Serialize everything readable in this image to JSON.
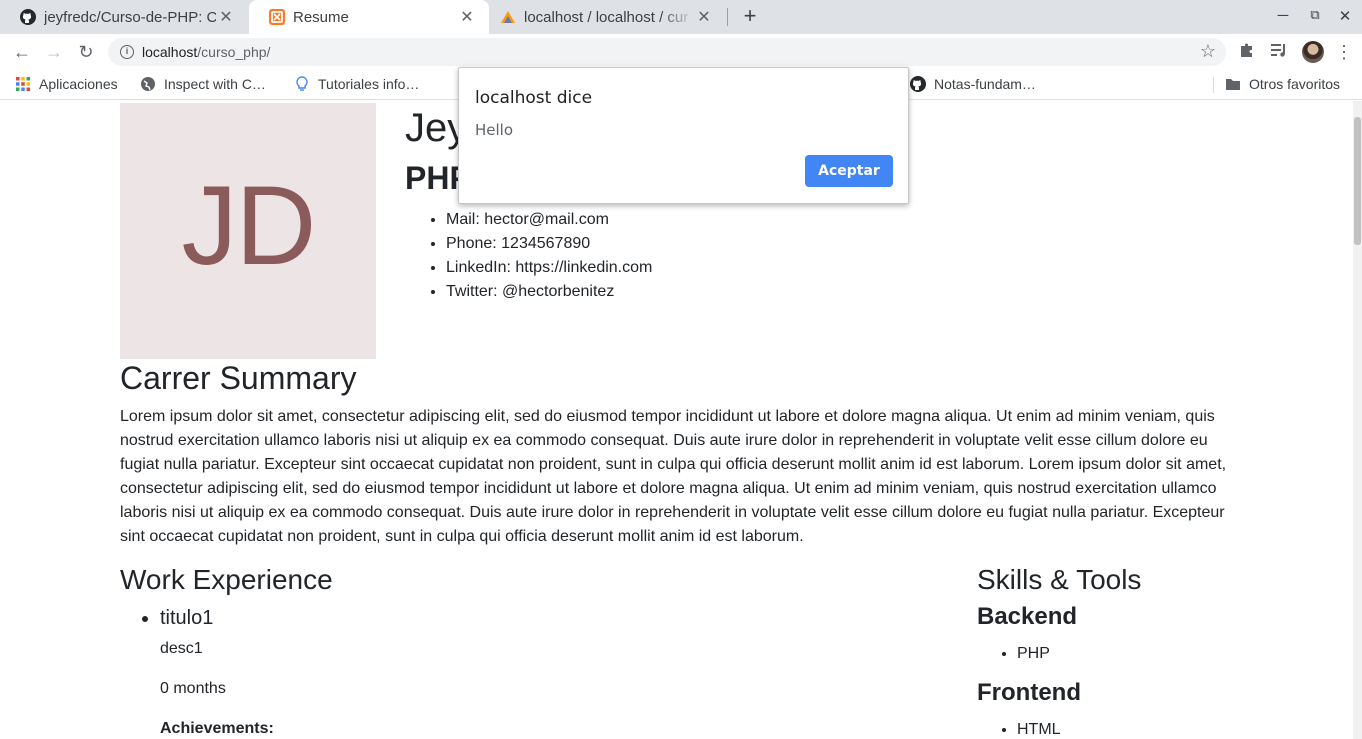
{
  "browser": {
    "tabs": [
      {
        "title": "jeyfredc/Curso-de-PHP: Cu",
        "icon": "github-icon",
        "active": false
      },
      {
        "title": "Resume",
        "icon": "xampp-icon",
        "active": true
      },
      {
        "title": "localhost / localhost / cur",
        "icon": "phpmyadmin-icon",
        "active": false
      }
    ],
    "new_tab": "+",
    "url_host": "localhost",
    "url_path": "/curso_php/",
    "bookmarks": [
      {
        "label": "Aplicaciones",
        "icon": "apps-grid-icon"
      },
      {
        "label": "Inspect with C…",
        "icon": "globe-icon"
      },
      {
        "label": "Tutoriales info…",
        "icon": "bulb-icon"
      },
      {
        "label": "Notas-fundam…",
        "icon": "github-icon"
      }
    ],
    "other_bookmarks": "Otros favoritos",
    "colors": {
      "tabstrip": "#dee1e6",
      "accent": "#4285f4"
    }
  },
  "dialog": {
    "title": "localhost dice",
    "message": "Hello",
    "button": "Aceptar"
  },
  "resume": {
    "initials": "JD",
    "name": "Jey",
    "job": "PHP",
    "contact": [
      "Mail: hector@mail.com",
      "Phone: 1234567890",
      "LinkedIn: https://linkedin.com",
      "Twitter: @hectorbenitez"
    ],
    "summary_heading": "Carrer Summary",
    "summary": "Lorem ipsum dolor sit amet, consectetur adipiscing elit, sed do eiusmod tempor incididunt ut labore et dolore magna aliqua. Ut enim ad minim veniam, quis nostrud exercitation ullamco laboris nisi ut aliquip ex ea commodo consequat. Duis aute irure dolor in reprehenderit in voluptate velit esse cillum dolore eu fugiat nulla pariatur. Excepteur sint occaecat cupidatat non proident, sunt in culpa qui officia deserunt mollit anim id est laborum. Lorem ipsum dolor sit amet, consectetur adipiscing elit, sed do eiusmod tempor incididunt ut labore et dolore magna aliqua. Ut enim ad minim veniam, quis nostrud exercitation ullamco laboris nisi ut aliquip ex ea commodo consequat. Duis aute irure dolor in reprehenderit in voluptate velit esse cillum dolore eu fugiat nulla pariatur. Excepteur sint occaecat cupidatat non proident, sunt in culpa qui officia deserunt mollit anim id est laborum.",
    "work_heading": "Work Experience",
    "work": {
      "title": "titulo1",
      "description": "desc1",
      "duration": "0 months",
      "achievements_label": "Achievements:"
    },
    "skills_heading": "Skills & Tools",
    "backend_heading": "Backend",
    "backend": [
      "PHP"
    ],
    "frontend_heading": "Frontend",
    "frontend": [
      "HTML"
    ]
  }
}
